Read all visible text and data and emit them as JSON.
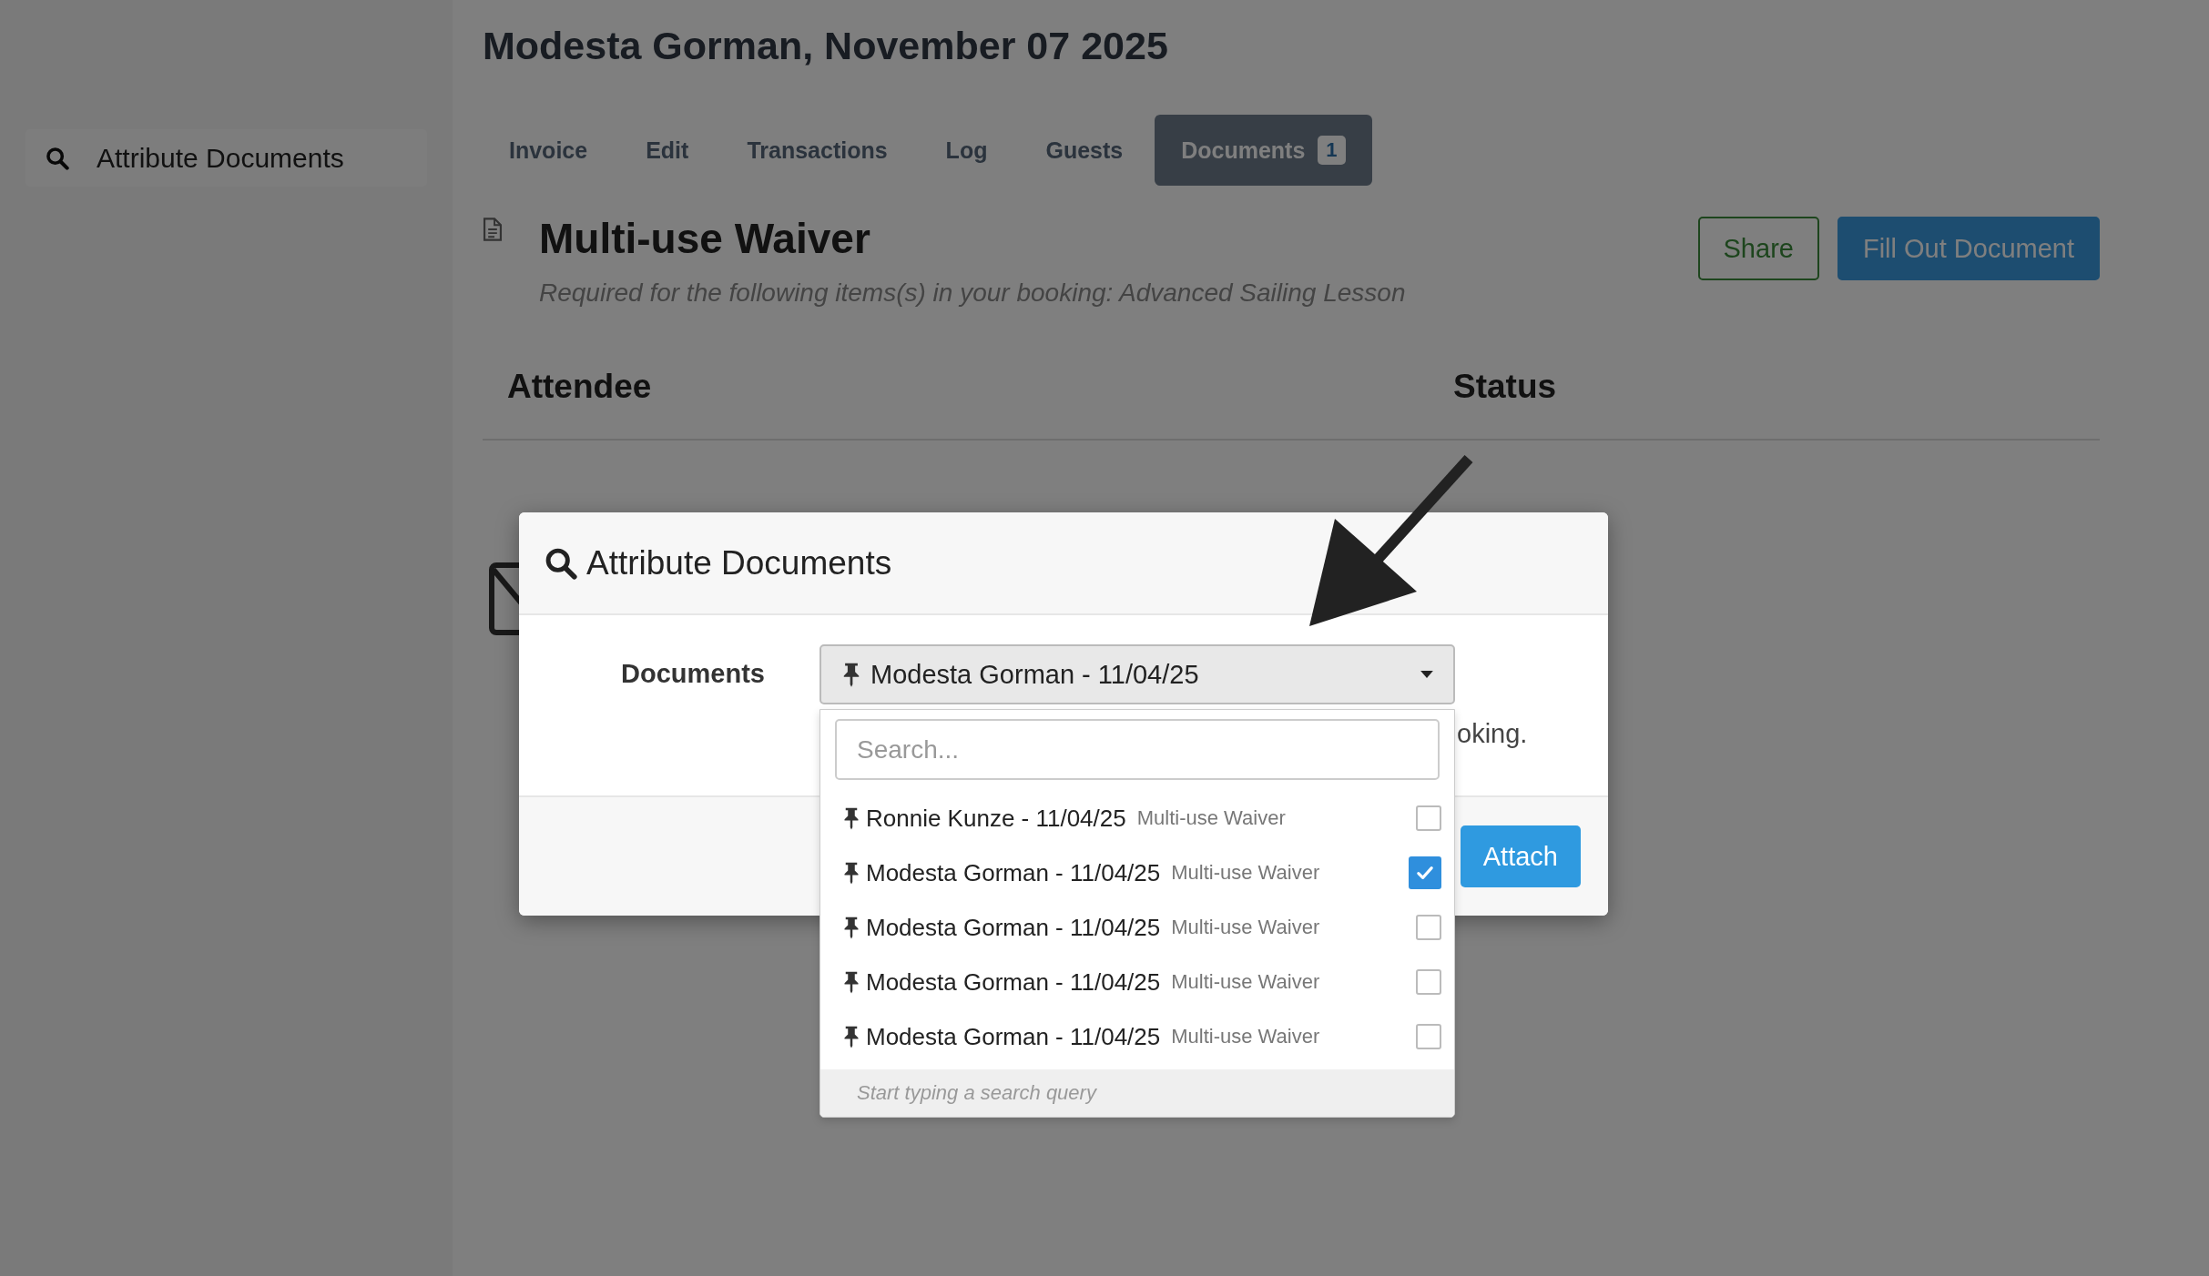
{
  "sidebar": {
    "items": [
      {
        "label": "Attribute Documents"
      }
    ]
  },
  "page": {
    "title": "Modesta Gorman, November 07 2025"
  },
  "tabs": [
    {
      "label": "Invoice",
      "selected": false
    },
    {
      "label": "Edit",
      "selected": false
    },
    {
      "label": "Transactions",
      "selected": false
    },
    {
      "label": "Log",
      "selected": false
    },
    {
      "label": "Guests",
      "selected": false
    },
    {
      "label": "Documents",
      "selected": true,
      "badge": "1"
    }
  ],
  "document": {
    "title": "Multi-use Waiver",
    "subtitle": "Required for the following items(s) in your booking: Advanced Sailing Lesson",
    "buttons": [
      {
        "label": "Share",
        "kind": "outline"
      },
      {
        "label": "Fill Out Document",
        "kind": "primary"
      }
    ]
  },
  "table": {
    "columns": [
      "Attendee",
      "Status"
    ]
  },
  "modal": {
    "title": "Attribute Documents",
    "field_label": "Documents",
    "select_value": "Modesta Gorman - 11/04/25",
    "help_text": "oking.",
    "button": "Attach",
    "dropdown": {
      "placeholder": "Search...",
      "footer": "Start typing a search query",
      "options": [
        {
          "label": "Ronnie Kunze - 11/04/25",
          "type": "Multi-use Waiver",
          "checked": false
        },
        {
          "label": "Modesta Gorman - 11/04/25",
          "type": "Multi-use Waiver",
          "checked": true
        },
        {
          "label": "Modesta Gorman - 11/04/25",
          "type": "Multi-use Waiver",
          "checked": false
        },
        {
          "label": "Modesta Gorman - 11/04/25",
          "type": "Multi-use Waiver",
          "checked": false
        },
        {
          "label": "Modesta Gorman - 11/04/25",
          "type": "Multi-use Waiver",
          "checked": false
        }
      ]
    }
  }
}
